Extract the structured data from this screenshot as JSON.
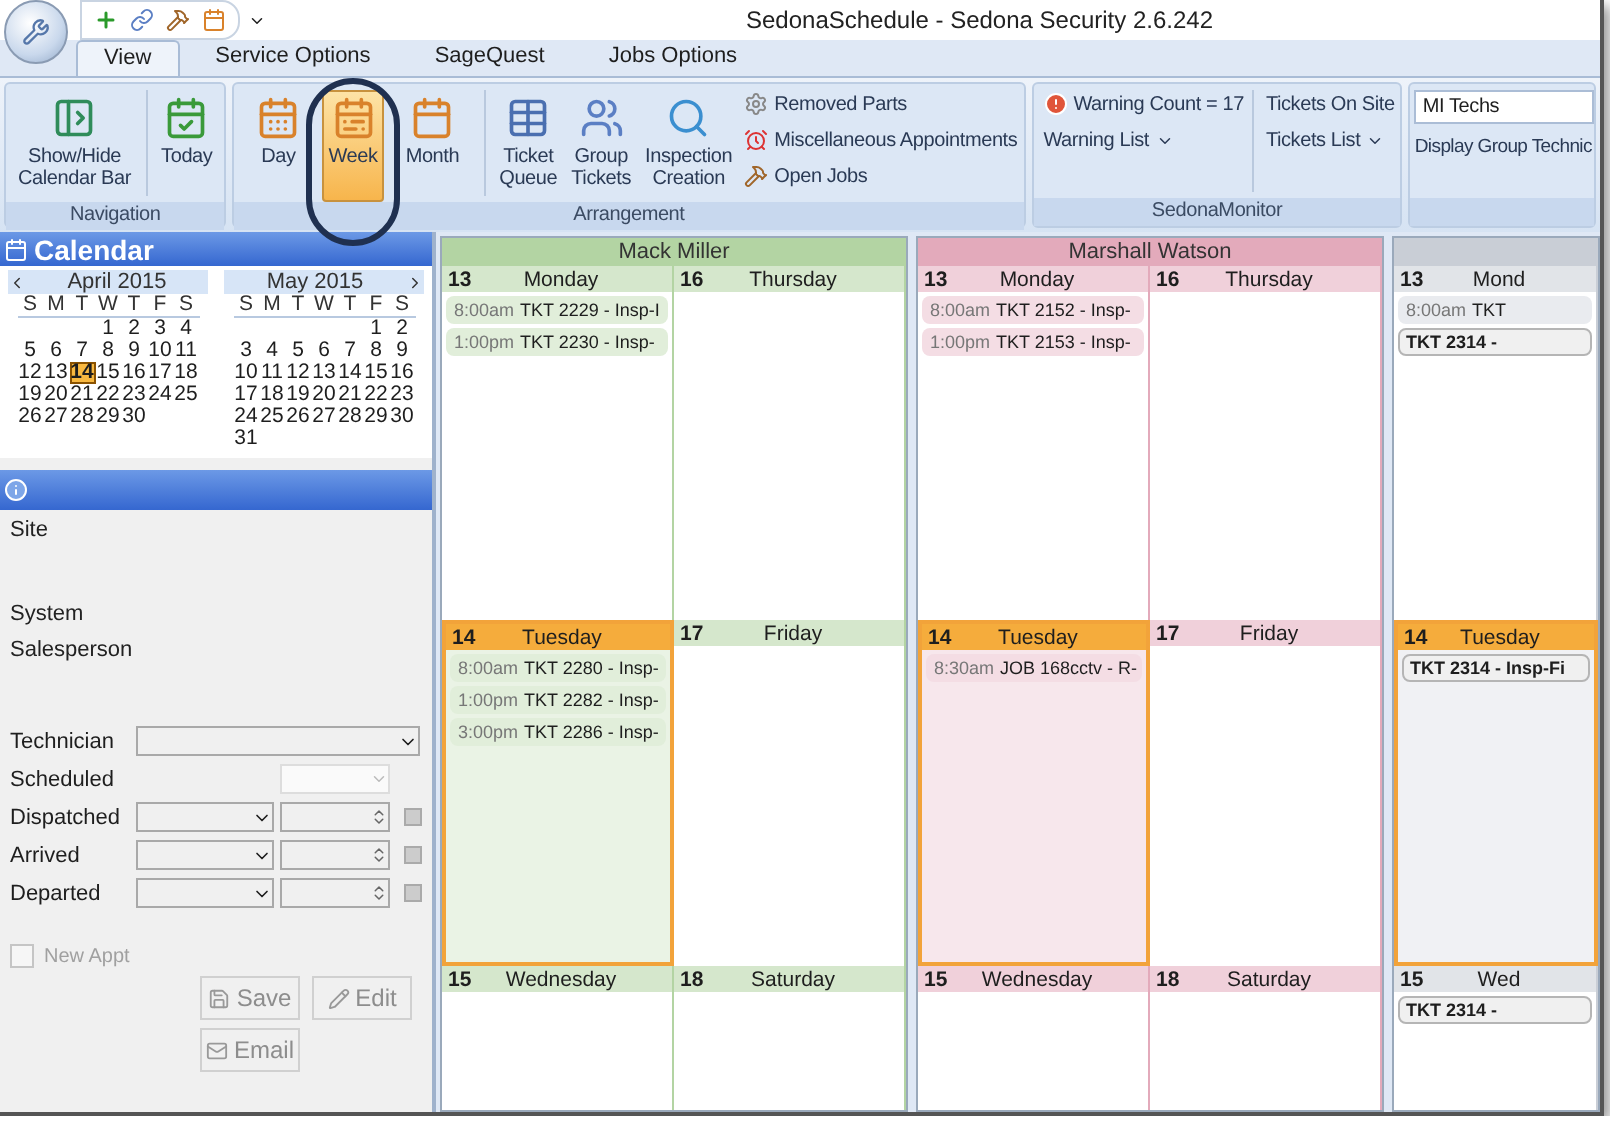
{
  "window": {
    "title": "SedonaSchedule - Sedona Security 2.6.242"
  },
  "tabs": [
    {
      "label": "View",
      "selected": true
    },
    {
      "label": "Service Options",
      "selected": false
    },
    {
      "label": "SageQuest",
      "selected": false
    },
    {
      "label": "Jobs Options",
      "selected": false
    }
  ],
  "ribbon": {
    "navigation": {
      "label": "Navigation",
      "buttons": [
        {
          "label": "Show/Hide\nCalendar Bar"
        },
        {
          "label": "Today"
        }
      ]
    },
    "arrangement": {
      "label": "Arrangement",
      "views": [
        {
          "label": "Day",
          "selected": false
        },
        {
          "label": "Week",
          "selected": true
        },
        {
          "label": "Month",
          "selected": false
        }
      ],
      "tools": [
        {
          "label": "Ticket\nQueue"
        },
        {
          "label": "Group\nTickets"
        },
        {
          "label": "Inspection\nCreation"
        }
      ],
      "links": [
        {
          "label": "Removed Parts"
        },
        {
          "label": "Miscellaneous Appointments"
        },
        {
          "label": "Open Jobs"
        }
      ]
    },
    "monitor": {
      "label": "SedonaMonitor",
      "warning": "Warning Count = 17",
      "warning_list": "Warning List",
      "tickets_on_site": "Tickets On Site",
      "tickets_list": "Tickets List"
    },
    "group": {
      "value": "MI Techs",
      "display": "Display Group Technic"
    }
  },
  "calendar": {
    "title": "Calendar",
    "months": [
      {
        "title": "April 2015",
        "weekdays": [
          "S",
          "M",
          "T",
          "W",
          "T",
          "F",
          "S"
        ],
        "weeks": [
          [
            {
              "d": "1",
              "selected": false
            },
            {
              "d": "2",
              "selected": false
            },
            {
              "d": "3",
              "selected": false
            },
            {
              "d": "4",
              "selected": false
            }
          ],
          [
            {
              "d": "5",
              "selected": false
            },
            {
              "d": "6",
              "selected": false
            },
            {
              "d": "7",
              "selected": false
            },
            {
              "d": "8",
              "selected": false
            },
            {
              "d": "9",
              "selected": false
            },
            {
              "d": "10",
              "selected": false
            },
            {
              "d": "11",
              "selected": false
            }
          ],
          [
            {
              "d": "12",
              "selected": false
            },
            {
              "d": "13",
              "selected": false
            },
            {
              "d": "14",
              "selected": true
            },
            {
              "d": "15",
              "selected": false
            },
            {
              "d": "16",
              "selected": false
            },
            {
              "d": "17",
              "selected": false
            },
            {
              "d": "18",
              "selected": false
            }
          ],
          [
            {
              "d": "19",
              "selected": false
            },
            {
              "d": "20",
              "selected": false
            },
            {
              "d": "21",
              "selected": false
            },
            {
              "d": "22",
              "selected": false
            },
            {
              "d": "23",
              "selected": false
            },
            {
              "d": "24",
              "selected": false
            },
            {
              "d": "25",
              "selected": false
            }
          ],
          [
            {
              "d": "26",
              "selected": false
            },
            {
              "d": "27",
              "selected": false
            },
            {
              "d": "28",
              "selected": false
            },
            {
              "d": "29",
              "selected": false
            },
            {
              "d": "30",
              "selected": false
            }
          ]
        ]
      },
      {
        "title": "May 2015",
        "weekdays": [
          "S",
          "M",
          "T",
          "W",
          "T",
          "F",
          "S"
        ],
        "weeks": [
          [
            {
              "d": "1",
              "selected": false
            },
            {
              "d": "2",
              "selected": false
            }
          ],
          [
            {
              "d": "3",
              "selected": false
            },
            {
              "d": "4",
              "selected": false
            },
            {
              "d": "5",
              "selected": false
            },
            {
              "d": "6",
              "selected": false
            },
            {
              "d": "7",
              "selected": false
            },
            {
              "d": "8",
              "selected": false
            },
            {
              "d": "9",
              "selected": false
            }
          ],
          [
            {
              "d": "10",
              "selected": false
            },
            {
              "d": "11",
              "selected": false
            },
            {
              "d": "12",
              "selected": false
            },
            {
              "d": "13",
              "selected": false
            },
            {
              "d": "14",
              "selected": false
            },
            {
              "d": "15",
              "selected": false
            },
            {
              "d": "16",
              "selected": false
            }
          ],
          [
            {
              "d": "17",
              "selected": false
            },
            {
              "d": "18",
              "selected": false
            },
            {
              "d": "19",
              "selected": false
            },
            {
              "d": "20",
              "selected": false
            },
            {
              "d": "21",
              "selected": false
            },
            {
              "d": "22",
              "selected": false
            },
            {
              "d": "23",
              "selected": false
            }
          ],
          [
            {
              "d": "24",
              "selected": false
            },
            {
              "d": "25",
              "selected": false
            },
            {
              "d": "26",
              "selected": false
            },
            {
              "d": "27",
              "selected": false
            },
            {
              "d": "28",
              "selected": false
            },
            {
              "d": "29",
              "selected": false
            },
            {
              "d": "30",
              "selected": false
            }
          ],
          [
            {
              "d": "31",
              "selected": false
            }
          ]
        ]
      }
    ]
  },
  "details": {
    "labels": [
      "Site",
      "System",
      "Salesperson"
    ],
    "technician": {
      "label": "Technician"
    },
    "scheduled": {
      "label": "Scheduled"
    },
    "times": [
      {
        "label": "Dispatched"
      },
      {
        "label": "Arrived"
      },
      {
        "label": "Departed"
      }
    ],
    "new_appt": {
      "label": "New Appt",
      "checked": false,
      "disabled": true
    },
    "buttons": [
      {
        "label": "Save",
        "disabled": true
      },
      {
        "label": "Edit",
        "disabled": true
      },
      {
        "label": "Email",
        "disabled": true
      }
    ]
  },
  "scheduler": {
    "technicians": [
      {
        "name": "Mack Miller",
        "color": "#b3d4a3",
        "days": [
          {
            "number": "13",
            "weekday": "Monday",
            "today": false,
            "appointments": [
              {
                "kind": "timed",
                "time": "8:00am",
                "title": "TKT 2229 - Insp-I"
              },
              {
                "kind": "timed",
                "time": "1:00pm",
                "title": "TKT 2230 - Insp-"
              }
            ]
          },
          {
            "number": "14",
            "weekday": "Tuesday",
            "today": true,
            "appointments": [
              {
                "kind": "timed",
                "time": "8:00am",
                "title": "TKT 2280 - Insp-"
              },
              {
                "kind": "timed",
                "time": "1:00pm",
                "title": "TKT 2282 - Insp-"
              },
              {
                "kind": "timed",
                "time": "3:00pm",
                "title": "TKT 2286 - Insp-"
              }
            ]
          },
          {
            "number": "15",
            "weekday": "Wednesday",
            "today": false
          },
          {
            "number": "16",
            "weekday": "Thursday",
            "today": false
          },
          {
            "number": "17",
            "weekday": "Friday",
            "today": false
          },
          {
            "number": "18",
            "weekday": "Saturday",
            "today": false
          }
        ]
      },
      {
        "name": "Marshall Watson",
        "color": "#e3aabb",
        "days": [
          {
            "number": "13",
            "weekday": "Monday",
            "today": false,
            "appointments": [
              {
                "kind": "timed",
                "time": "8:00am",
                "title": "TKT 2152 - Insp-"
              },
              {
                "kind": "timed",
                "time": "1:00pm",
                "title": "TKT 2153 - Insp-"
              }
            ]
          },
          {
            "number": "14",
            "weekday": "Tuesday",
            "today": true,
            "appointments": [
              {
                "kind": "timed",
                "time": "8:30am",
                "title": "JOB 168cctv - R-"
              }
            ]
          },
          {
            "number": "15",
            "weekday": "Wednesday",
            "today": false
          },
          {
            "number": "16",
            "weekday": "Thursday",
            "today": false
          },
          {
            "number": "17",
            "weekday": "Friday",
            "today": false
          },
          {
            "number": "18",
            "weekday": "Saturday",
            "today": false
          }
        ]
      },
      {
        "color": "#c9ced6",
        "days": [
          {
            "number": "13",
            "weekday": "Mond",
            "today": false,
            "appointments": [
              {
                "kind": "timed",
                "time": "8:00am",
                "title": "TKT"
              },
              {
                "kind": "allday",
                "title": "TKT 2314 -"
              }
            ]
          },
          {
            "number": "14",
            "weekday": "Tuesday",
            "today": true,
            "appointments": [
              {
                "kind": "allday",
                "title": "TKT 2314 - Insp-Fi"
              }
            ]
          },
          {
            "number": "15",
            "weekday": "Wed",
            "today": false,
            "appointments": [
              {
                "kind": "allday",
                "title": "TKT 2314 -"
              }
            ]
          }
        ]
      }
    ]
  }
}
